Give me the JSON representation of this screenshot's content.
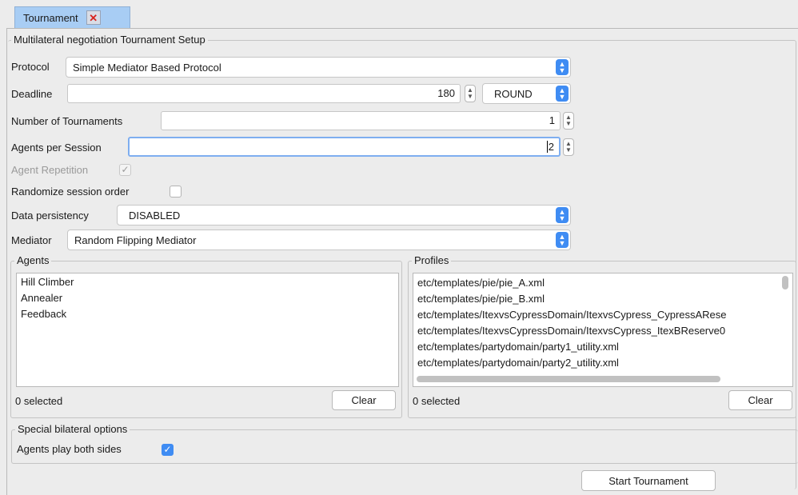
{
  "tab": {
    "label": "Tournament"
  },
  "setup": {
    "legend": "Multilateral negotiation Tournament Setup",
    "protocol": {
      "label": "Protocol",
      "value": "Simple Mediator Based Protocol"
    },
    "deadline": {
      "label": "Deadline",
      "value": "180",
      "unit": "ROUND"
    },
    "tournaments": {
      "label": "Number of Tournaments",
      "value": "1"
    },
    "agents_per_session": {
      "label": "Agents per Session",
      "value": "2"
    },
    "agent_repetition": {
      "label": "Agent Repetition",
      "checked": true
    },
    "randomize": {
      "label": "Randomize session order",
      "checked": false
    },
    "persistency": {
      "label": "Data persistency",
      "value": "DISABLED"
    },
    "mediator": {
      "label": "Mediator",
      "value": "Random Flipping Mediator"
    }
  },
  "agents": {
    "legend": "Agents",
    "items": [
      "Hill Climber",
      "Annealer",
      "Feedback"
    ],
    "status": "0 selected",
    "clear_label": "Clear"
  },
  "profiles": {
    "legend": "Profiles",
    "items": [
      "etc/templates/pie/pie_A.xml",
      "etc/templates/pie/pie_B.xml",
      "etc/templates/ItexvsCypressDomain/ItexvsCypress_CypressARese",
      "etc/templates/ItexvsCypressDomain/ItexvsCypress_ItexBReserve0",
      "etc/templates/partydomain/party1_utility.xml",
      "etc/templates/partydomain/party2_utility.xml"
    ],
    "status": "0 selected",
    "clear_label": "Clear"
  },
  "bilateral": {
    "legend": "Special bilateral options",
    "both_sides": {
      "label": "Agents play both sides",
      "checked": true
    }
  },
  "start_label": "Start Tournament",
  "colors": {
    "accent": "#3f8cf3",
    "tab": "#a8cdf4",
    "close": "#d8231e"
  }
}
